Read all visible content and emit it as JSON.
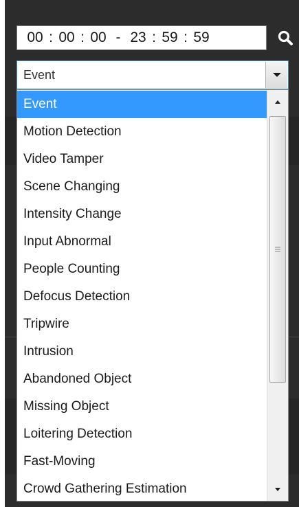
{
  "time_range": {
    "start_hh": "00",
    "start_mm": "00",
    "start_ss": "00",
    "end_hh": "23",
    "end_mm": "59",
    "end_ss": "59",
    "separator": ":",
    "range_dash": "-"
  },
  "search_icon": "search-icon",
  "event_select": {
    "selected_value": "Event",
    "options": [
      "Event",
      "Motion Detection",
      "Video Tamper",
      "Scene Changing",
      "Intensity Change",
      "Input Abnormal",
      "People Counting",
      "Defocus Detection",
      "Tripwire",
      "Intrusion",
      "Abandoned Object",
      "Missing Object",
      "Loitering Detection",
      "Fast-Moving",
      "Crowd Gathering Estimation"
    ],
    "highlighted_option": "Event"
  },
  "colors": {
    "panel_background": "#2c2c2c",
    "highlight": "#3399ff",
    "select_border": "#4a90c8"
  }
}
